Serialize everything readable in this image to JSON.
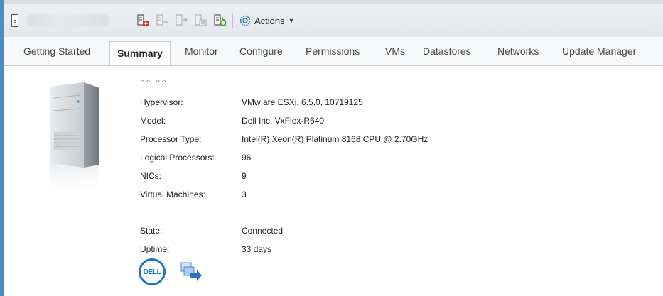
{
  "toolbar": {
    "actions_label": "Actions"
  },
  "tabs": [
    {
      "label": "Getting Started"
    },
    {
      "label": "Summary"
    },
    {
      "label": "Monitor"
    },
    {
      "label": "Configure"
    },
    {
      "label": "Permissions"
    },
    {
      "label": "VMs"
    },
    {
      "label": "Datastores"
    },
    {
      "label": "Networks"
    },
    {
      "label": "Update Manager"
    }
  ],
  "summary": {
    "truncated_heading": "˄˄ ˄˄",
    "props": [
      {
        "key": "Hypervisor:",
        "value": "VMw are ESXi, 6.5.0, 10719125"
      },
      {
        "key": "Model:",
        "value": "Dell Inc. VxFlex-R640"
      },
      {
        "key": "Processor Type:",
        "value": "Intel(R) Xeon(R) Platinum 8168 CPU @ 2.70GHz"
      },
      {
        "key": "Logical Processors:",
        "value": "96"
      },
      {
        "key": "NICs:",
        "value": "9"
      },
      {
        "key": "Virtual Machines:",
        "value": "3"
      }
    ],
    "status": [
      {
        "key": "State:",
        "value": "Connected"
      },
      {
        "key": "Uptime:",
        "value": "33 days"
      }
    ],
    "vendor_logo_text": "DELL"
  },
  "icons": [
    "host-icon",
    "add-host-icon",
    "remove-host-icon",
    "exit-maintenance-icon",
    "maintenance-mode-icon",
    "reboot-host-icon",
    "gear-icon",
    "chevron-down-icon",
    "server-icon",
    "dell-logo",
    "migrate-icon"
  ],
  "colors": {
    "accent": "#4a8ec5",
    "dell_blue": "#1a76c4"
  }
}
